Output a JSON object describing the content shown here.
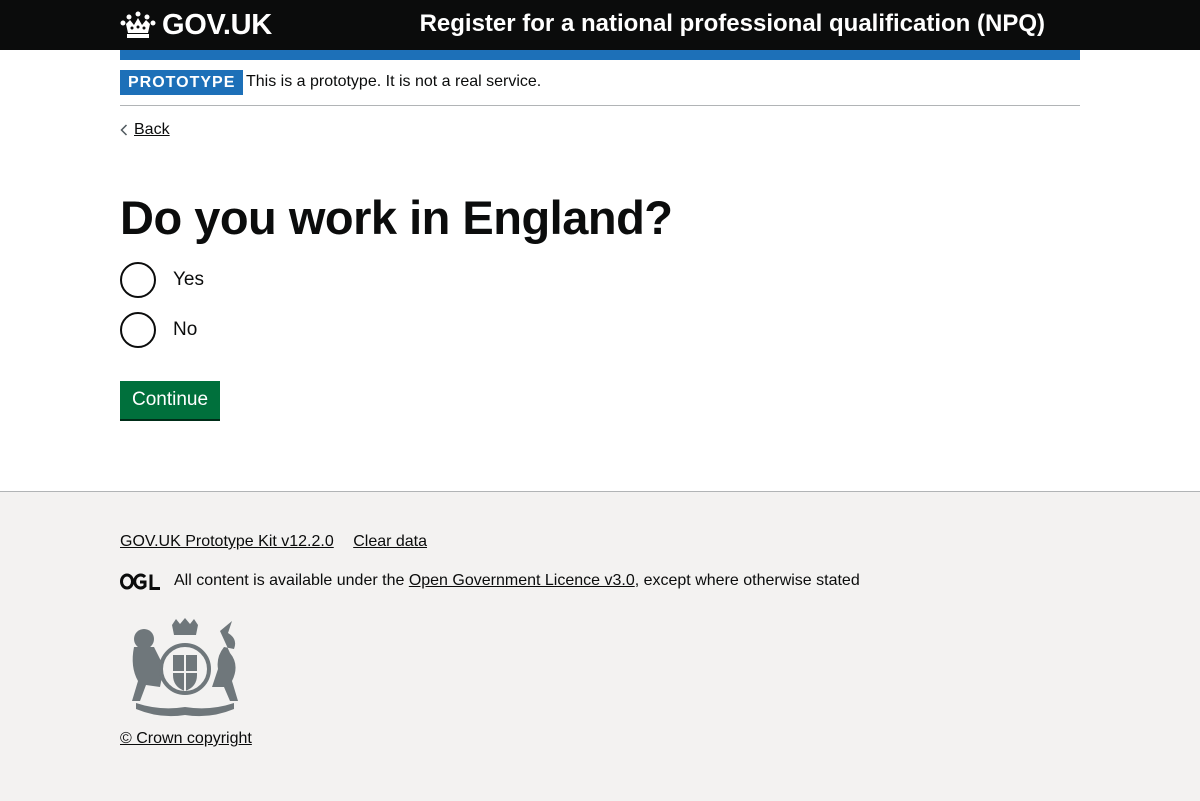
{
  "header": {
    "logo_text": "GOV.UK",
    "service_name": "Register for a national professional qualification (NPQ)"
  },
  "phase_banner": {
    "tag": "PROTOTYPE",
    "text": "This is a prototype. It is not a real service."
  },
  "back_link": {
    "label": "Back"
  },
  "question": {
    "heading": "Do you work in England?",
    "options": [
      {
        "label": "Yes",
        "selected": false
      },
      {
        "label": "No",
        "selected": false
      }
    ]
  },
  "actions": {
    "continue_label": "Continue"
  },
  "footer": {
    "links": [
      "GOV.UK Prototype Kit v12.2.0",
      "Clear data"
    ],
    "licence_prefix": "All content is available under the ",
    "licence_link": "Open Government Licence v3.0",
    "licence_suffix": ", except where otherwise stated",
    "copyright": "© Crown copyright"
  },
  "colors": {
    "header_bg": "#0b0c0c",
    "brand_blue": "#1d70b8",
    "button_green": "#00703c",
    "footer_bg": "#f3f2f1"
  },
  "icons": [
    "crown-icon",
    "chevron-left-icon",
    "ogl-logo",
    "royal-crest"
  ]
}
